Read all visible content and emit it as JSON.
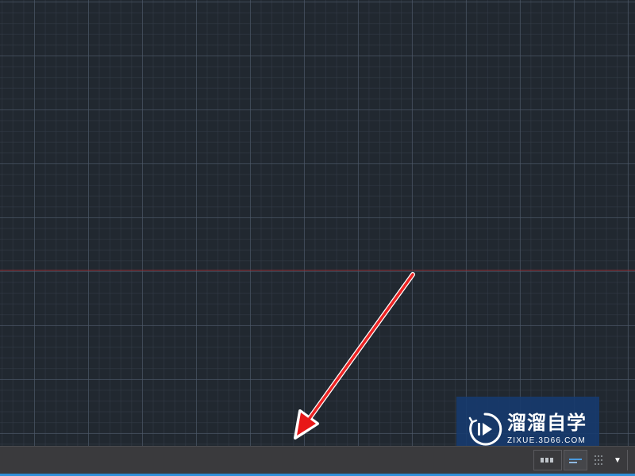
{
  "canvas": {
    "background_color": "#212830",
    "grid": true,
    "major_grid_color": "#505c6c",
    "minor_grid_color": "#343c48",
    "x_axis_color": "#8a2f36"
  },
  "annotation": {
    "type": "red-arrow",
    "color": "#ee1c1c",
    "points_to": "status-bar"
  },
  "status_bar": {
    "background_color": "#3a3a3d",
    "accent_color": "#2f8fd8",
    "buttons": [
      {
        "name": "status-button-a",
        "icon": "toolbar-icon"
      },
      {
        "name": "status-button-b",
        "icon": "toolbar-icon"
      },
      {
        "name": "status-grip",
        "icon": "grip-icon"
      },
      {
        "name": "status-menu",
        "icon": "triangle-down-icon",
        "glyph": "▼"
      }
    ]
  },
  "watermark": {
    "title": "溜溜自学",
    "url": "ZIXUE.3D66.COM",
    "background_color": "#163a70",
    "logo_icon": "play-logo-icon"
  }
}
